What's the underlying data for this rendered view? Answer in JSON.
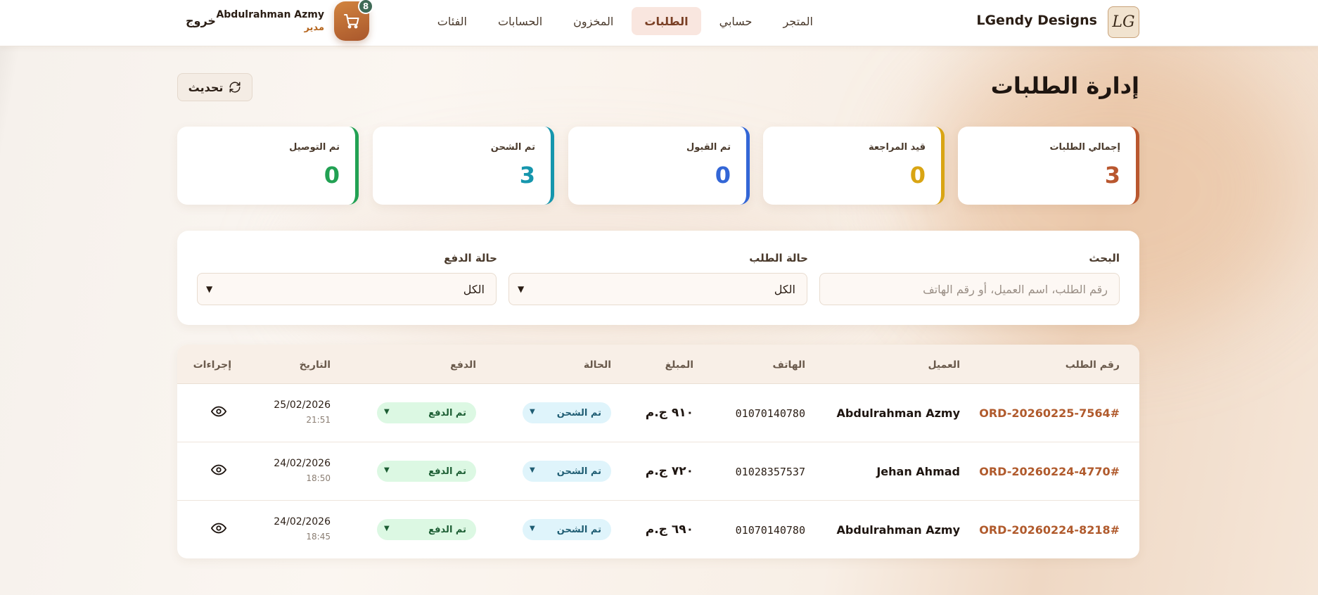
{
  "header": {
    "logo_text": "LG",
    "brand": "LGendy Designs",
    "nav": [
      {
        "label": "المتجر",
        "active": false
      },
      {
        "label": "حسابي",
        "active": false
      },
      {
        "label": "الطلبات",
        "active": true
      },
      {
        "label": "المخزون",
        "active": false
      },
      {
        "label": "الحسابات",
        "active": false
      },
      {
        "label": "الفئات",
        "active": false
      }
    ],
    "cart_count": "8",
    "user_name": "Abdulrahman Azmy",
    "user_role": "مدير",
    "logout_label": "خروج"
  },
  "page": {
    "title": "إدارة الطلبات",
    "refresh_label": "تحديث"
  },
  "stats": [
    {
      "label": "إجمالي الطلبات",
      "value": "3",
      "color": "#b9572f"
    },
    {
      "label": "قيد المراجعة",
      "value": "0",
      "color": "#d9a514"
    },
    {
      "label": "تم القبول",
      "value": "0",
      "color": "#3366d6"
    },
    {
      "label": "تم الشحن",
      "value": "3",
      "color": "#1696ad"
    },
    {
      "label": "تم التوصيل",
      "value": "0",
      "color": "#22a153"
    }
  ],
  "filters": {
    "search_label": "البحث",
    "search_placeholder": "رقم الطلب، اسم العميل، أو رقم الهاتف",
    "status_label": "حالة الطلب",
    "status_value": "الكل",
    "payment_label": "حالة الدفع",
    "payment_value": "الكل"
  },
  "table": {
    "headers": {
      "order_id": "رقم الطلب",
      "customer": "العميل",
      "phone": "الهاتف",
      "amount": "المبلغ",
      "status": "الحالة",
      "payment": "الدفع",
      "date": "التاريخ",
      "actions": "إجراءات"
    },
    "rows": [
      {
        "order_id": "ORD-20260225-7564#",
        "customer": "Abdulrahman Azmy",
        "phone": "01070140780",
        "amount": "٩١٠ ج.م",
        "status": "تم الشحن",
        "payment": "تم الدفع",
        "date": "25/02/2026",
        "time": "21:51"
      },
      {
        "order_id": "ORD-20260224-4770#",
        "customer": "Jehan Ahmad",
        "phone": "01028357537",
        "amount": "٧٢٠ ج.م",
        "status": "تم الشحن",
        "payment": "تم الدفع",
        "date": "24/02/2026",
        "time": "18:50"
      },
      {
        "order_id": "ORD-20260224-8218#",
        "customer": "Abdulrahman Azmy",
        "phone": "01070140780",
        "amount": "٦٩٠ ج.م",
        "status": "تم الشحن",
        "payment": "تم الدفع",
        "date": "24/02/2026",
        "time": "18:45"
      }
    ]
  }
}
